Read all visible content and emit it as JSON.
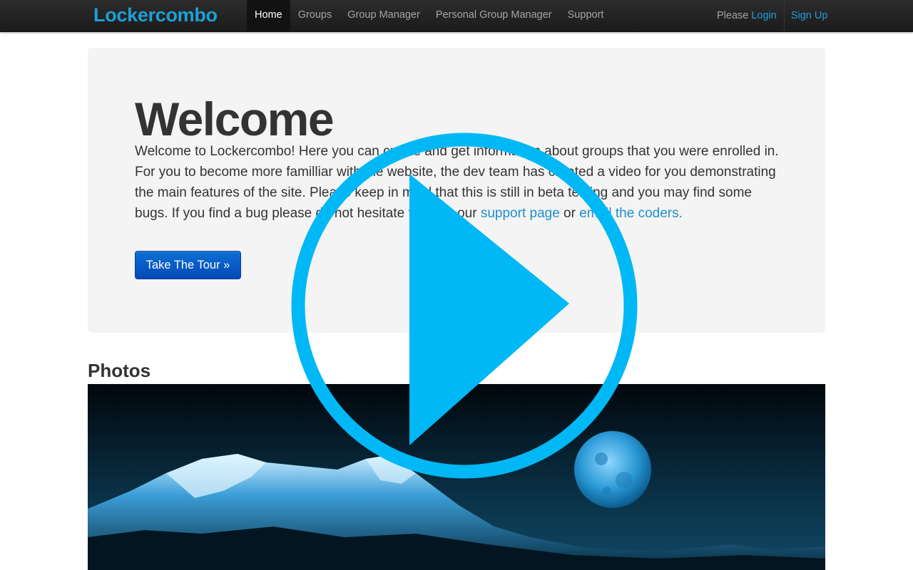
{
  "navbar": {
    "brand": "Lockercombo",
    "items": [
      {
        "label": "Home"
      },
      {
        "label": "Groups"
      },
      {
        "label": "Group Manager"
      },
      {
        "label": "Personal Group Manager"
      },
      {
        "label": "Support"
      }
    ],
    "please": "Please",
    "login": "Login",
    "signup": "Sign Up",
    "brand_color": "#1e9fd8"
  },
  "hero": {
    "title": "Welcome",
    "text_part1": "Welcome to Lockercombo! Here you can create and get information about groups that you were enrolled in. For you to become more familliar with the website, the dev team has created a video for you demonstrating the main features of the site. Please keep in mind that this is still in beta testing and you may find some bugs. If you find a bug please do not hesitate to go to our ",
    "support_link": "support page",
    "text_or": " or ",
    "email_link": "email the coders.",
    "button": "Take The Tour »"
  },
  "photos": {
    "title": "Photos",
    "image": "mountain-moon-night-photo"
  },
  "overlay": {
    "icon": "play-icon",
    "color": "#00b8f5"
  }
}
